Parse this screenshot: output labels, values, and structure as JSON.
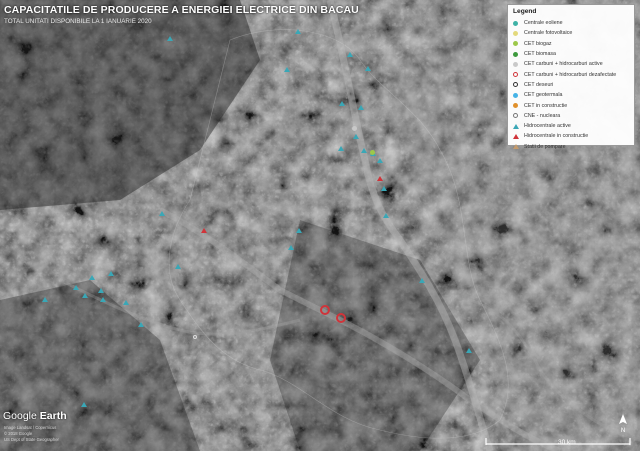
{
  "map": {
    "title": "CAPACITATILE DE PRODUCERE A ENERGIEI ELECTRICE DIN BACAU",
    "subtitle": "TOTAL UNITATI DISPONIBILE LA 1 IANUARIE 2020",
    "base_colors": {
      "terrain": "#4a4a4a",
      "valley": "#8a8a8a",
      "dark": "#1e1e1e"
    }
  },
  "legend": {
    "title": "Legend",
    "items": [
      {
        "label": "Centrale eoliene",
        "shape": "dot",
        "color": "#3fb2a6"
      },
      {
        "label": "Centrale fotovoltaice",
        "shape": "dot",
        "color": "#e3d97c"
      },
      {
        "label": "CET biogaz",
        "shape": "dot",
        "color": "#9dc84a"
      },
      {
        "label": "CET biomasa",
        "shape": "dot",
        "color": "#3e9a3e"
      },
      {
        "label": "CET carbuni + hidrocarburi active",
        "shape": "dot",
        "color": "#c9c9c9"
      },
      {
        "label": "CET carbuni + hidrocarburi dezafectate",
        "shape": "ring",
        "color": "#d0343a"
      },
      {
        "label": "CET deseuri",
        "shape": "ring",
        "color": "#333333"
      },
      {
        "label": "CET geotermala",
        "shape": "dot",
        "color": "#46b3e6"
      },
      {
        "label": "CET in constructie",
        "shape": "dot",
        "color": "#e0912d"
      },
      {
        "label": "CNE - nucleara",
        "shape": "ring",
        "color": "#777777"
      },
      {
        "label": "Hidrocentrale active",
        "shape": "tri",
        "color": "#3aa7b6"
      },
      {
        "label": "Hidrocentrale in constructie",
        "shape": "tri",
        "color": "#d0343a"
      },
      {
        "label": "Statii de pompare",
        "shape": "tri",
        "color": "#c49a6c"
      }
    ]
  },
  "markers": [
    {
      "type": "hidro-activ",
      "x": 0.265,
      "y": 0.087
    },
    {
      "type": "hidro-activ",
      "x": 0.466,
      "y": 0.072
    },
    {
      "type": "hidro-activ",
      "x": 0.547,
      "y": 0.122
    },
    {
      "type": "hidro-activ",
      "x": 0.575,
      "y": 0.153
    },
    {
      "type": "hidro-activ",
      "x": 0.448,
      "y": 0.155
    },
    {
      "type": "hidro-activ",
      "x": 0.534,
      "y": 0.231
    },
    {
      "type": "hidro-activ",
      "x": 0.564,
      "y": 0.239
    },
    {
      "type": "hidro-activ",
      "x": 0.533,
      "y": 0.33
    },
    {
      "type": "hidro-activ",
      "x": 0.556,
      "y": 0.304
    },
    {
      "type": "hidro-activ",
      "x": 0.569,
      "y": 0.334
    },
    {
      "type": "hidro-activ",
      "x": 0.583,
      "y": 0.341
    },
    {
      "type": "hidro-activ",
      "x": 0.594,
      "y": 0.357
    },
    {
      "type": "hidro-activ",
      "x": 0.6,
      "y": 0.419
    },
    {
      "type": "hidro-activ",
      "x": 0.603,
      "y": 0.479
    },
    {
      "type": "hidro-activ",
      "x": 0.467,
      "y": 0.512
    },
    {
      "type": "hidro-activ",
      "x": 0.455,
      "y": 0.549
    },
    {
      "type": "hidro-activ",
      "x": 0.253,
      "y": 0.475
    },
    {
      "type": "hidro-activ",
      "x": 0.278,
      "y": 0.591
    },
    {
      "type": "hidro-activ",
      "x": 0.173,
      "y": 0.608
    },
    {
      "type": "hidro-activ",
      "x": 0.143,
      "y": 0.617
    },
    {
      "type": "hidro-activ",
      "x": 0.119,
      "y": 0.638
    },
    {
      "type": "hidro-activ",
      "x": 0.133,
      "y": 0.657
    },
    {
      "type": "hidro-activ",
      "x": 0.158,
      "y": 0.646
    },
    {
      "type": "hidro-activ",
      "x": 0.161,
      "y": 0.665
    },
    {
      "type": "hidro-activ",
      "x": 0.197,
      "y": 0.672
    },
    {
      "type": "hidro-activ",
      "x": 0.07,
      "y": 0.666
    },
    {
      "type": "hidro-activ",
      "x": 0.22,
      "y": 0.72
    },
    {
      "type": "hidro-activ",
      "x": 0.659,
      "y": 0.623
    },
    {
      "type": "hidro-activ",
      "x": 0.733,
      "y": 0.779
    },
    {
      "type": "hidro-activ",
      "x": 0.131,
      "y": 0.899
    },
    {
      "type": "hidro-constructie",
      "x": 0.319,
      "y": 0.513
    },
    {
      "type": "hidro-constructie",
      "x": 0.594,
      "y": 0.396
    },
    {
      "type": "cet-dezafectat",
      "x": 0.508,
      "y": 0.688
    },
    {
      "type": "cet-dezafectat",
      "x": 0.533,
      "y": 0.706
    },
    {
      "type": "cet-activ",
      "x": 0.555,
      "y": 0.285
    },
    {
      "type": "cet-deseuri",
      "x": 0.305,
      "y": 0.748
    },
    {
      "type": "biomasa",
      "x": 0.582,
      "y": 0.338
    }
  ],
  "google_earth": {
    "logo_word1": "Google",
    "logo_word2": "Earth",
    "credit_lines": [
      "Image Landsat / Copernicus",
      "© 2018 Google",
      "US Dept of State Geographer"
    ]
  },
  "scale": {
    "label": "30 km"
  },
  "north": {
    "label": "N"
  }
}
